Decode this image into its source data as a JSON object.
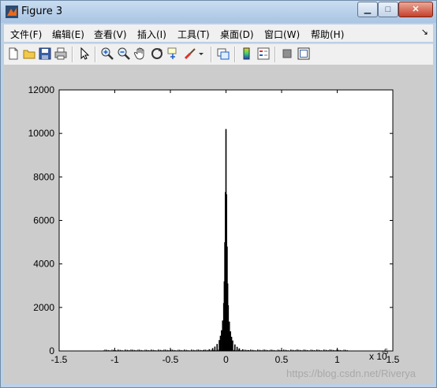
{
  "window": {
    "title": "Figure 3"
  },
  "window_buttons": {
    "minimize": "▁",
    "maximize": "□",
    "close": "✕"
  },
  "menu": {
    "items": [
      "文件(F)",
      "编辑(E)",
      "查看(V)",
      "插入(I)",
      "工具(T)",
      "桌面(D)",
      "窗口(W)",
      "帮助(H)"
    ],
    "overflow": "↘"
  },
  "toolbar": {
    "icons": [
      "new-file-icon",
      "open-folder-icon",
      "save-icon",
      "print-icon",
      "pointer-icon",
      "zoom-in-icon",
      "zoom-out-icon",
      "pan-hand-icon",
      "rotate-3d-icon",
      "data-cursor-icon",
      "brush-icon",
      "link-plot-icon",
      "colorbar-icon",
      "legend-icon",
      "hide-plot-tools-icon",
      "show-plot-tools-icon"
    ]
  },
  "chart_data": {
    "type": "bar",
    "title": "",
    "xlabel": "",
    "ylabel": "",
    "xlim": [
      -1.5,
      1.5
    ],
    "ylim": [
      0,
      12000
    ],
    "x_tick_labels": [
      "-1.5",
      "-1",
      "-0.5",
      "0",
      "0.5",
      "1",
      "1.5"
    ],
    "y_tick_labels": [
      "0",
      "2000",
      "4000",
      "6000",
      "8000",
      "10000",
      "12000"
    ],
    "x_multiplier_label": "x 10",
    "x_multiplier_exponent": "-5",
    "series": [
      {
        "x": [
          -0.2,
          -0.15,
          -0.12,
          -0.1,
          -0.08,
          -0.06,
          -0.05,
          -0.04,
          -0.03,
          -0.02,
          -0.015,
          -0.01,
          -0.005,
          0,
          0.005,
          0.01,
          0.015,
          0.02,
          0.03,
          0.04,
          0.05,
          0.06,
          0.08,
          0.1,
          0.12,
          0.15,
          0.2
        ],
        "values": [
          40,
          80,
          130,
          200,
          320,
          500,
          700,
          950,
          1400,
          2200,
          3200,
          5000,
          7300,
          10200,
          7200,
          4800,
          3100,
          2100,
          1350,
          900,
          650,
          480,
          300,
          190,
          120,
          75,
          40
        ]
      }
    ],
    "baseline_noise_range": [
      -1.1,
      1.1
    ],
    "grid": false,
    "legend": "none"
  },
  "watermark": "https://blog.csdn.net/Riverya"
}
